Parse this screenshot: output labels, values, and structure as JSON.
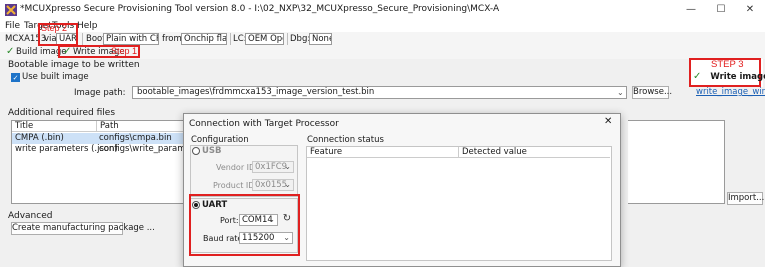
{
  "window": {
    "title": "*MCUXpresso Secure Provisioning Tool version 8.0 - I:\\02_NXP\\32_MCUXpresso_Secure_Provisioning\\MCX-A",
    "minimize": "—",
    "maximize": "☐",
    "close": "✕"
  },
  "menu": [
    "File",
    "Target",
    "Tools",
    "Help"
  ],
  "toolbar": {
    "device": "MCXA153",
    "via_label": "via",
    "connection": "UART",
    "boot_label": "Boot",
    "boot_value": "Plain with CRC",
    "from_label": "from",
    "from_value": "Onchip flash",
    "lc_label": "LC:",
    "lc_value": "OEM Open",
    "dbg_label": "Dbg:",
    "dbg_value": "None"
  },
  "tabs": {
    "build": "Build image",
    "write": "Write image"
  },
  "annotations": {
    "step1": "Step 1",
    "step2": "Step 2",
    "step3": "STEP 3",
    "accent": "#e02020"
  },
  "main": {
    "bootable_title": "Bootable image to be written",
    "use_built_image": "Use built image",
    "image_path_label": "Image path:",
    "image_path_value": "bootable_images\\frdmmcxa153_image_version_test.bin",
    "browse_button": "Browse...",
    "write_image_button": "Write image",
    "write_image_script": "write_image_win.bat",
    "additional_title": "Additional required files",
    "table": {
      "headers": [
        "Title",
        "Path"
      ],
      "rows": [
        [
          "CMPA (.bin)",
          "configs\\cmpa.bin"
        ],
        [
          "write parameters (.json)",
          "configs\\write_parameters.js"
        ]
      ]
    },
    "import_button": "Import...",
    "advanced_title": "Advanced",
    "create_package_button": "Create manufacturing package ..."
  },
  "dialog": {
    "title": "Connection with Target Processor",
    "close": "✕",
    "configuration_title": "Configuration",
    "usb_label": "USB",
    "vendor_id_label": "Vendor ID:",
    "vendor_id_value": "0x1FC9",
    "product_id_label": "Product ID:",
    "product_id_value": "0x0155",
    "uart_label": "UART",
    "port_label": "Port:",
    "port_value": "COM14",
    "baud_label": "Baud rate:",
    "baud_value": "115200",
    "status_title": "Connection status",
    "status_headers": [
      "Feature",
      "Detected value"
    ]
  }
}
